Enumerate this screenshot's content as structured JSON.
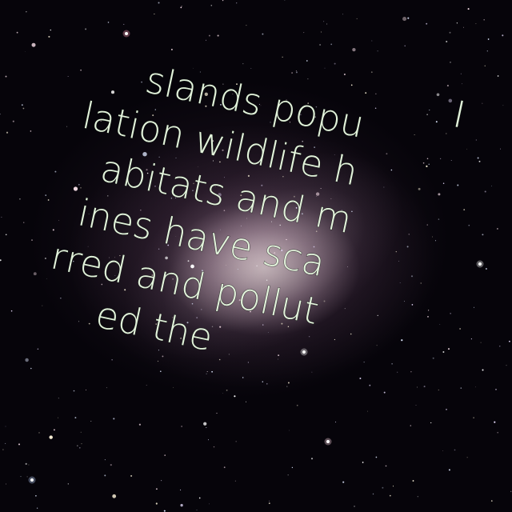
{
  "photo": {
    "subject": "galaxy-icon",
    "text_color": "#e3f3dc",
    "lines": [
      "I",
      "slands popu",
      "lation wildlife h",
      "abitats and m",
      "ines have sca",
      "rred and pollut",
      "ed the"
    ]
  }
}
